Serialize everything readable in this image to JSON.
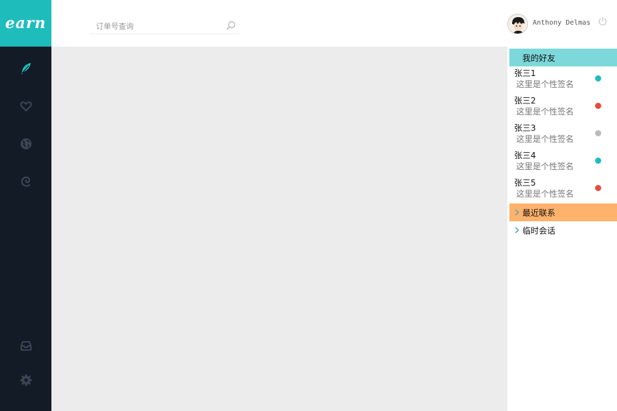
{
  "app": {
    "logo_text": "earn"
  },
  "header": {
    "search_placeholder": "订单号查询",
    "username": "Anthony Delmas"
  },
  "sidebar": {
    "items": [
      {
        "icon": "feather-icon",
        "active": true,
        "color": "#1fbcbc"
      },
      {
        "icon": "heart-icon",
        "active": false,
        "color": "#3a4452"
      },
      {
        "icon": "globe-icon",
        "active": false,
        "color": "#3a4452"
      },
      {
        "icon": "swirl-icon",
        "active": false,
        "color": "#3a4452"
      },
      {
        "icon": "inbox-icon",
        "active": false,
        "color": "#3a4452"
      },
      {
        "icon": "gear-icon",
        "active": false,
        "color": "#3a4452"
      }
    ]
  },
  "panel": {
    "friends_title": "我的好友",
    "friends": [
      {
        "name": "张三1",
        "signature": "这里是个性签名",
        "status_color": "#1fbcbc"
      },
      {
        "name": "张三2",
        "signature": "这里是个性签名",
        "status_color": "#e74c3c"
      },
      {
        "name": "张三3",
        "signature": "这里是个性签名",
        "status_color": "#bbbbbb"
      },
      {
        "name": "张三4",
        "signature": "这里是个性签名",
        "status_color": "#1fbcbc"
      },
      {
        "name": "张三5",
        "signature": "这里是个性签名",
        "status_color": "#e74c3c"
      }
    ],
    "recent_title": "最近联系",
    "temp_title": "临时会话"
  },
  "colors": {
    "accent": "#1fbcbc",
    "sidebar_bg": "#131b26",
    "friends_header": "#7dd8db",
    "recent_header": "#ffb26b"
  }
}
